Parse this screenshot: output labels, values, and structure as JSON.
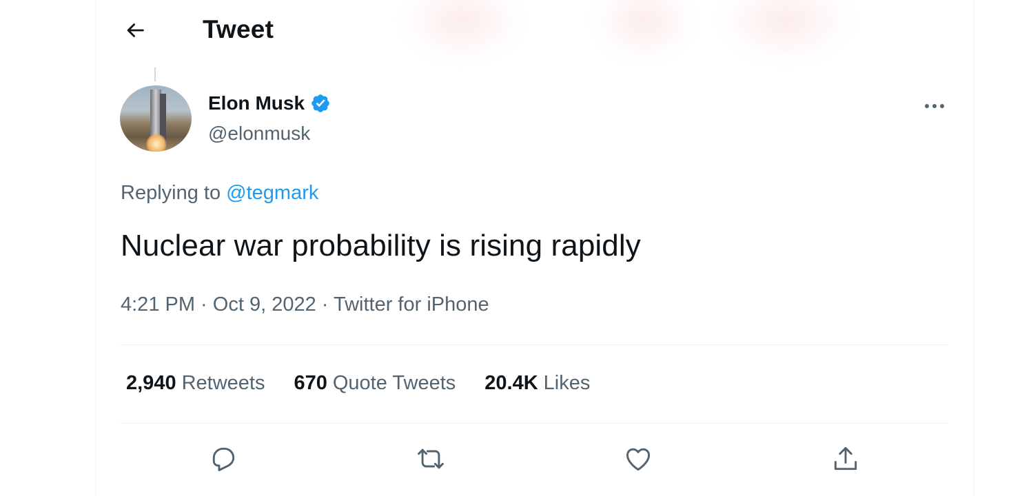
{
  "header": {
    "title": "Tweet"
  },
  "author": {
    "name": "Elon Musk",
    "handle": "@elonmusk",
    "verified": true
  },
  "reply": {
    "prefix": "Replying to ",
    "to": "@tegmark"
  },
  "tweet": {
    "text": "Nuclear war probability is rising rapidly"
  },
  "meta": {
    "time": "4:21 PM",
    "separator": " · ",
    "date": "Oct 9, 2022",
    "source": "Twitter for iPhone"
  },
  "stats": [
    {
      "count": "2,940",
      "label": "Retweets"
    },
    {
      "count": "670",
      "label": "Quote Tweets"
    },
    {
      "count": "20.4K",
      "label": "Likes"
    }
  ],
  "actions": [
    "reply-icon",
    "retweet-icon",
    "like-icon",
    "share-icon"
  ],
  "colors": {
    "accent": "#1d9bf0",
    "secondary_text": "#536471",
    "primary_text": "#0f1419",
    "divider": "#eff3f4"
  }
}
